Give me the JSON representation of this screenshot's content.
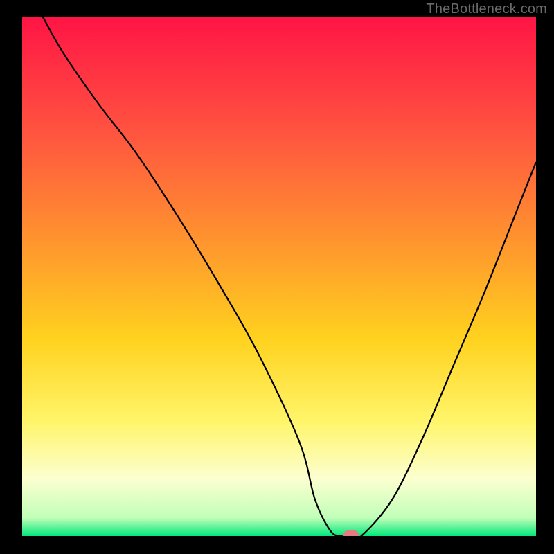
{
  "watermark": "TheBottleneck.com",
  "chart_data": {
    "type": "line",
    "title": "",
    "xlabel": "",
    "ylabel": "",
    "xlim": [
      0,
      100
    ],
    "ylim": [
      0,
      100
    ],
    "grid": false,
    "background_gradient": {
      "description": "vertical gradient red→orange→yellow→pale-yellow→green from top to bottom",
      "stops": [
        {
          "offset": 0.0,
          "color": "#ff1445"
        },
        {
          "offset": 0.22,
          "color": "#ff5340"
        },
        {
          "offset": 0.45,
          "color": "#ff9a2d"
        },
        {
          "offset": 0.62,
          "color": "#ffd21e"
        },
        {
          "offset": 0.78,
          "color": "#fff56a"
        },
        {
          "offset": 0.89,
          "color": "#fcffd0"
        },
        {
          "offset": 0.965,
          "color": "#c1ffb8"
        },
        {
          "offset": 1.0,
          "color": "#00e87a"
        }
      ]
    },
    "series": [
      {
        "name": "bottleneck-curve",
        "color": "#000000",
        "x": [
          4,
          8,
          15,
          22,
          30,
          38,
          46,
          54,
          57,
          60,
          62,
          64,
          66,
          72,
          78,
          84,
          90,
          96,
          100
        ],
        "y": [
          100,
          93,
          83,
          74,
          62,
          49,
          35,
          18,
          7,
          1,
          0,
          0,
          0,
          7,
          19,
          33,
          47,
          62,
          72
        ]
      }
    ],
    "marker": {
      "name": "optimal-point",
      "x": 64,
      "y": 0,
      "color": "#e77b80"
    }
  }
}
